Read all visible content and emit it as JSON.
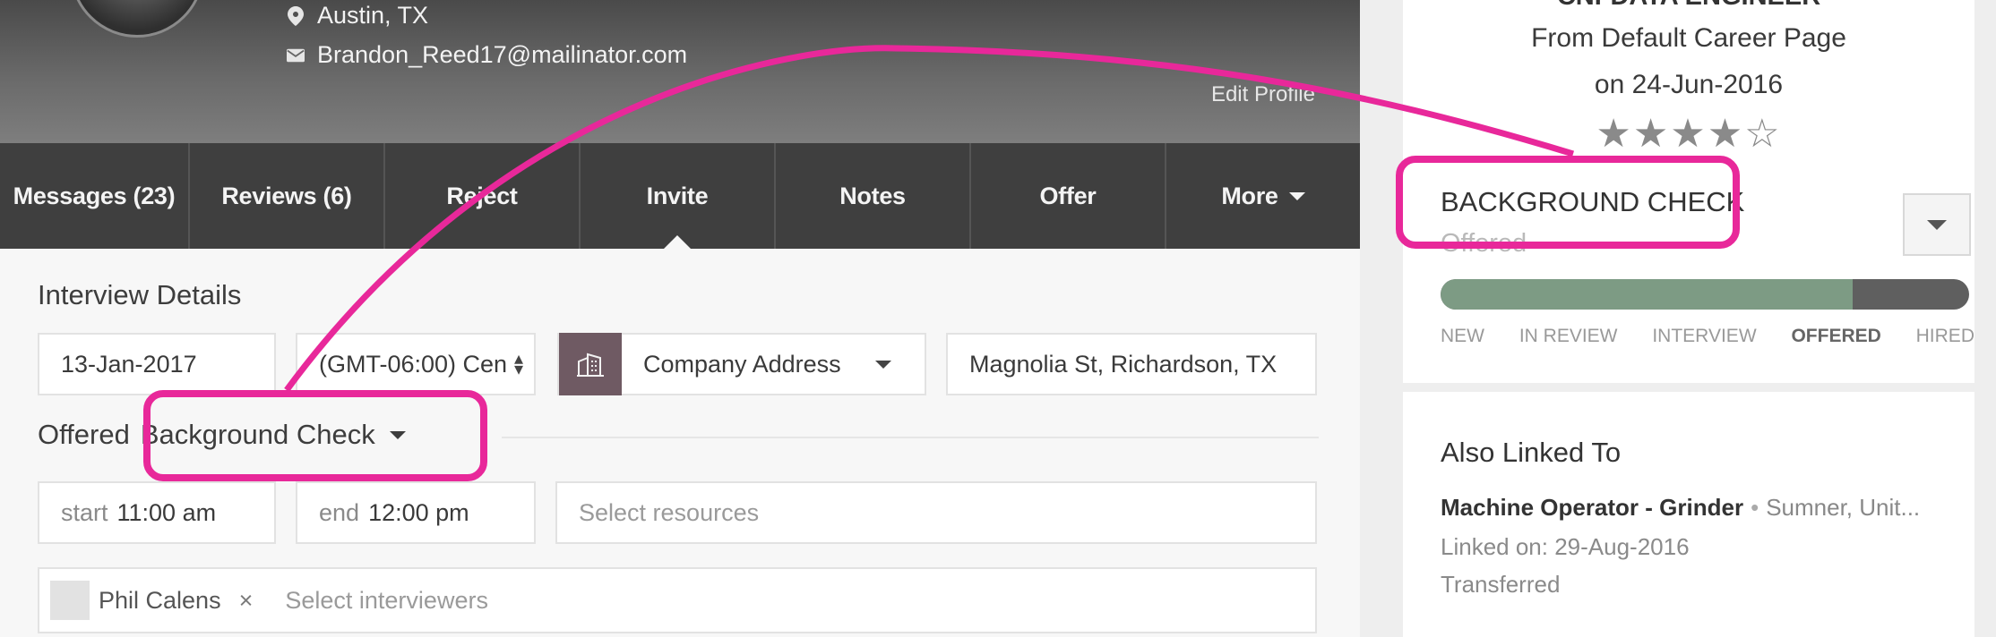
{
  "profile": {
    "location": "Austin, TX",
    "email": "Brandon_Reed17@mailinator.com",
    "edit_profile": "Edit Profile"
  },
  "tabs": [
    {
      "label": "Messages (23)"
    },
    {
      "label": "Reviews (6)"
    },
    {
      "label": "Reject"
    },
    {
      "label": "Invite"
    },
    {
      "label": "Notes"
    },
    {
      "label": "Offer"
    },
    {
      "label": "More"
    }
  ],
  "active_tab": "Invite",
  "interview": {
    "title": "Interview Details",
    "date": "13-Jan-2017",
    "timezone": "(GMT-06:00) Cen",
    "address_type": "Company Address",
    "address": "Magnolia St, Richardson, TX",
    "stage_label": "Offered",
    "stage_value": "Background Check",
    "start_label": "start",
    "start_time": "11:00 am",
    "end_label": "end",
    "end_time": "12:00 pm",
    "resources_placeholder": "Select resources",
    "interviewer_tag": "Phil Calens",
    "interviewers_placeholder": "Select interviewers"
  },
  "candidate_card": {
    "job_title": "CNFDATA ENGINEER",
    "source": "From Default Career Page",
    "date": "on 24-Jun-2016",
    "rating_stars": "★★★★☆",
    "rating": 4,
    "status_title": "BACKGROUND CHECK",
    "status_sub": "Offered",
    "progress": 0.78,
    "stages": [
      "NEW",
      "IN REVIEW",
      "INTERVIEW",
      "OFFERED",
      "HIRED"
    ],
    "current_stage": "OFFERED"
  },
  "also_linked": {
    "title": "Also Linked To",
    "job": "Machine Operator - Grinder",
    "separator": "•",
    "location": "Sumner, Unit...",
    "linked_on": "Linked on: 29-Aug-2016",
    "status": "Transferred"
  },
  "colors": {
    "highlight": "#e8289a",
    "progress_fill": "#7d9b84",
    "tabbar": "#3f3f3f"
  }
}
